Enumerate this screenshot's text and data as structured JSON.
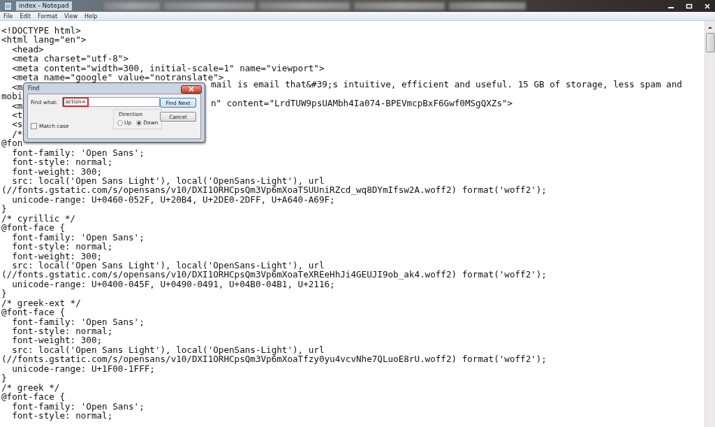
{
  "window": {
    "title": "index - Notepad"
  },
  "menu": [
    "File",
    "Edit",
    "Format",
    "View",
    "Help"
  ],
  "editor": {
    "lines": [
      {
        "text": "<!DOCTYPE html>"
      },
      {
        "text": "<html lang=\"en\">"
      },
      {
        "text": "  <head>"
      },
      {
        "text": "  <meta charset=\"utf-8\">"
      },
      {
        "text": "  <meta content=\"width=300, initial-scale=1\" name=\"viewport\">"
      },
      {
        "text": "  <meta name=\"google\" value=\"notranslate\">"
      },
      {
        "text": "  <m",
        "after": "mail is email that&#39;s intuitive, efficient and useful. 15 GB of storage, less spam and"
      },
      {
        "text": "mobi"
      },
      {
        "text": "  <m",
        "after": "n\" content=\"LrdTUW9psUAMbh4Ia074-BPEVmcpBxF6Gwf0MSgQXZs\">"
      },
      {
        "text": "  <t"
      },
      {
        "text": "  <s"
      },
      {
        "text": "  /*"
      },
      {
        "text": "@fon"
      },
      {
        "text": "  font-family: 'Open Sans';"
      },
      {
        "text": "  font-style: normal;"
      },
      {
        "text": "  font-weight: 300;"
      },
      {
        "text": "  src: local('Open Sans Light'), local('OpenSans-Light'), url"
      },
      {
        "text": "(//fonts.gstatic.com/s/opensans/v10/DXI1ORHCpsQm3Vp6mXoaTSUUniRZcd_wq8DYmIfsw2A.woff2) format('woff2');"
      },
      {
        "text": "  unicode-range: U+0460-052F, U+20B4, U+2DE0-2DFF, U+A640-A69F;"
      },
      {
        "text": "}"
      },
      {
        "text": "/* cyrillic */"
      },
      {
        "text": "@font-face {"
      },
      {
        "text": "  font-family: 'Open Sans';"
      },
      {
        "text": "  font-style: normal;"
      },
      {
        "text": "  font-weight: 300;"
      },
      {
        "text": "  src: local('Open Sans Light'), local('OpenSans-Light'), url"
      },
      {
        "text": "(//fonts.gstatic.com/s/opensans/v10/DXI1ORHCpsQm3Vp6mXoaTeXREeHhJi4GEUJI9ob_ak4.woff2) format('woff2');"
      },
      {
        "text": "  unicode-range: U+0400-045F, U+0490-0491, U+04B0-04B1, U+2116;"
      },
      {
        "text": "}"
      },
      {
        "text": "/* greek-ext */"
      },
      {
        "text": "@font-face {"
      },
      {
        "text": "  font-family: 'Open Sans';"
      },
      {
        "text": "  font-style: normal;"
      },
      {
        "text": "  font-weight: 300;"
      },
      {
        "text": "  src: local('Open Sans Light'), local('OpenSans-Light'), url"
      },
      {
        "text": "(//fonts.gstatic.com/s/opensans/v10/DXI1ORHCpsQm3Vp6mXoaTfzy0yu4vcvNhe7QLuoE8rU.woff2) format('woff2');"
      },
      {
        "text": "  unicode-range: U+1F00-1FFF;"
      },
      {
        "text": "}"
      },
      {
        "text": "/* greek */"
      },
      {
        "text": "@font-face {"
      },
      {
        "text": "  font-family: 'Open Sans';"
      },
      {
        "text": "  font-style: normal;"
      }
    ]
  },
  "find_dialog": {
    "title": "Find",
    "find_what_label": "Find what:",
    "find_what_value": "action=",
    "highlighted": true,
    "buttons": [
      "Find Next",
      "Cancel"
    ],
    "direction": {
      "label": "Direction",
      "options": [
        {
          "label": "Up",
          "selected": false
        },
        {
          "label": "Down",
          "selected": true
        }
      ]
    },
    "match_case": {
      "label": "Match case",
      "checked": false
    }
  }
}
